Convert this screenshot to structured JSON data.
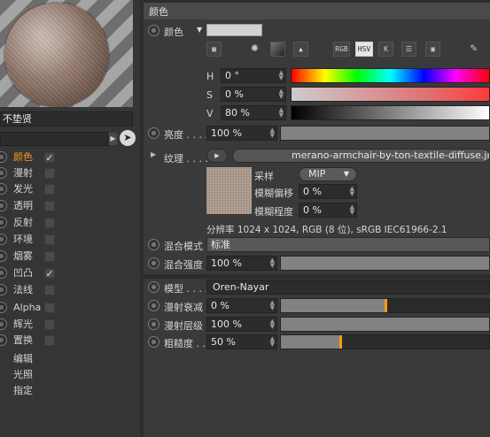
{
  "left": {
    "material_name": "不垫贤",
    "channels": [
      {
        "label": "颜色",
        "checked": true,
        "active": true
      },
      {
        "label": "漫射",
        "checked": false,
        "active": false
      },
      {
        "label": "发光",
        "checked": false,
        "active": false
      },
      {
        "label": "透明",
        "checked": false,
        "active": false
      },
      {
        "label": "反射",
        "checked": false,
        "active": false
      },
      {
        "label": "环境",
        "checked": false,
        "active": false
      },
      {
        "label": "烟雾",
        "checked": false,
        "active": false
      },
      {
        "label": "凹凸",
        "checked": true,
        "active": false
      },
      {
        "label": "法线",
        "checked": false,
        "active": false
      },
      {
        "label": "Alpha",
        "checked": false,
        "active": false
      },
      {
        "label": "辉光",
        "checked": false,
        "active": false
      },
      {
        "label": "置换",
        "checked": false,
        "active": false
      }
    ],
    "sub_items": [
      "编辑",
      "光照",
      "指定"
    ]
  },
  "section": {
    "title": "颜色"
  },
  "color": {
    "label": "颜色",
    "swatch": "#d2d2d2",
    "tools": [
      "grid-icon",
      "wheel-icon",
      "gradient-icon",
      "image-icon",
      "RGB",
      "HSV",
      "K",
      "sliders-icon",
      "mixer-icon",
      "eyedropper-icon"
    ],
    "tool_labels": {
      "rgb": "RGB",
      "hsv": "HSV",
      "k": "K"
    },
    "h_label": "H",
    "h_value": "0 °",
    "s_label": "S",
    "s_value": "0 %",
    "v_label": "V",
    "v_value": "80 %"
  },
  "brightness": {
    "label": "亮度 . . . .",
    "value": "100 %",
    "level": 1.0
  },
  "texture": {
    "label": "纹理 . . . .",
    "file": "merano-armchair-by-ton-textile-diffuse.jpg",
    "sample_label": "采样",
    "sample_value": "MIP",
    "blur_offset_label": "模糊偏移",
    "blur_offset_value": "0 %",
    "blur_amount_label": "模糊程度",
    "blur_amount_value": "0 %",
    "resolution": "分辨率 1024 x 1024, RGB (8 位), sRGB IEC61966-2.1"
  },
  "blend": {
    "mode_label": "混合模式",
    "mode_value": "标准",
    "strength_label": "混合强度",
    "strength_value": "100 %",
    "strength_level": 1.0
  },
  "model": {
    "label": "模型 . . . .",
    "value": "Oren-Nayar",
    "diffuse_falloff_label": "漫射衰减",
    "diffuse_falloff_value": "0 %",
    "diffuse_falloff_level": 0.5,
    "diffuse_level_label": "漫射层级",
    "diffuse_level_value": "100 %",
    "diffuse_level_level": 1.0,
    "roughness_label": "粗糙度 . .",
    "roughness_value": "50 %",
    "roughness_level": 0.5
  }
}
